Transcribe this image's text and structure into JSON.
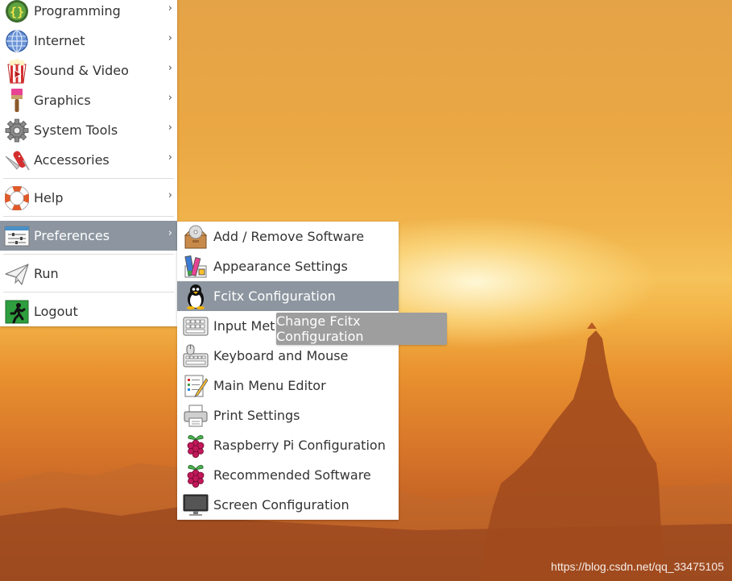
{
  "main_menu": {
    "items": [
      {
        "label": "Programming",
        "icon": "braces-icon",
        "has_submenu": true
      },
      {
        "label": "Internet",
        "icon": "globe-icon",
        "has_submenu": true
      },
      {
        "label": "Sound & Video",
        "icon": "popcorn-icon",
        "has_submenu": true
      },
      {
        "label": "Graphics",
        "icon": "paintbrush-icon",
        "has_submenu": true
      },
      {
        "label": "System Tools",
        "icon": "gear-icon",
        "has_submenu": true
      },
      {
        "label": "Accessories",
        "icon": "pocketknife-icon",
        "has_submenu": true
      },
      {
        "label": "Help",
        "icon": "lifebuoy-icon",
        "has_submenu": true
      },
      {
        "label": "Preferences",
        "icon": "sliders-icon",
        "has_submenu": true,
        "highlighted": true
      },
      {
        "label": "Run",
        "icon": "paper-plane-icon",
        "has_submenu": false
      },
      {
        "label": "Logout",
        "icon": "exit-icon",
        "has_submenu": false
      }
    ],
    "arrow_glyph": "›"
  },
  "preferences_submenu": {
    "items": [
      {
        "label": "Add / Remove Software",
        "icon": "package-disc-icon"
      },
      {
        "label": "Appearance Settings",
        "icon": "palette-icon"
      },
      {
        "label": "Fcitx Configuration",
        "icon": "penguin-icon",
        "highlighted": true
      },
      {
        "label": "Input Method",
        "icon": "keyboard-grid-icon"
      },
      {
        "label": "Keyboard and Mouse",
        "icon": "keyboard-mouse-icon"
      },
      {
        "label": "Main Menu Editor",
        "icon": "menu-editor-icon"
      },
      {
        "label": "Print Settings",
        "icon": "printer-icon"
      },
      {
        "label": "Raspberry Pi Configuration",
        "icon": "raspberry-icon"
      },
      {
        "label": "Recommended Software",
        "icon": "raspberry-icon"
      },
      {
        "label": "Screen Configuration",
        "icon": "monitor-icon"
      }
    ]
  },
  "tooltip": {
    "text": "Change Fcitx Configuration"
  },
  "watermark": {
    "text": "https://blog.csdn.net/qq_33475105"
  },
  "colors": {
    "highlight": "#8d96a0",
    "menu_bg": "#ffffff",
    "tooltip_bg": "#9e9e9e"
  }
}
